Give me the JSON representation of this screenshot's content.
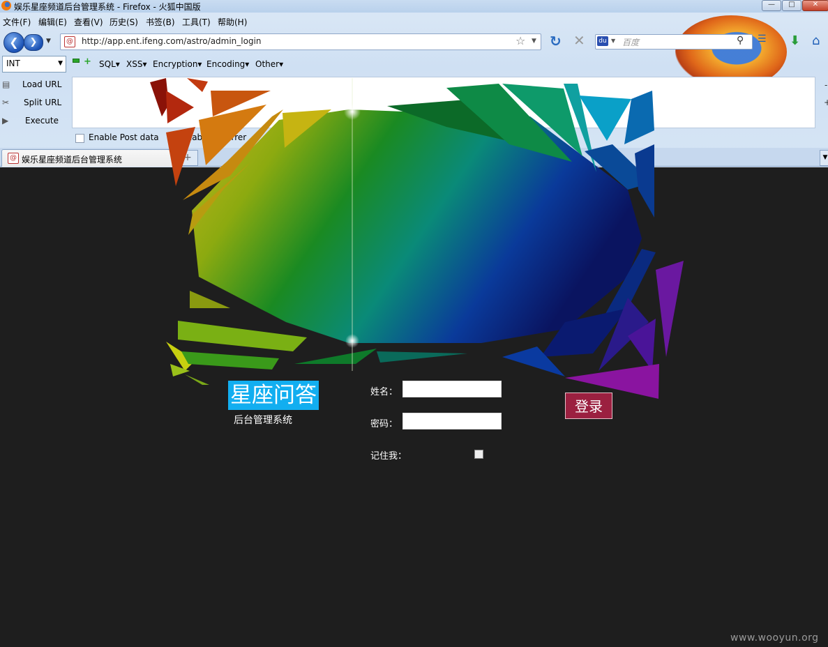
{
  "window": {
    "title": "娱乐星座频道后台管理系统 - Firefox - 火狐中国版",
    "min_glyph": "—",
    "max_glyph": "□",
    "close_glyph": "✕"
  },
  "menubar": {
    "items": [
      "文件(F)",
      "编辑(E)",
      "查看(V)",
      "历史(S)",
      "书签(B)",
      "工具(T)",
      "帮助(H)"
    ]
  },
  "navbar": {
    "url": "http://app.ent.ifeng.com/astro/admin_login",
    "search_placeholder": "百度",
    "engine_label": "du"
  },
  "hackbar": {
    "type_select": "INT",
    "menus": [
      "SQL▾",
      "XSS▾",
      "Encryption▾",
      "Encoding▾",
      "Other▾"
    ],
    "actions": [
      "Load URL",
      "Split URL",
      "Execute"
    ],
    "textarea_value": "",
    "checkboxes": [
      "Enable Post data",
      "Enable Referrer"
    ]
  },
  "tabs": {
    "active_label": "娱乐星座频道后台管理系统",
    "new_tab_glyph": "+"
  },
  "login": {
    "title": "星座问答",
    "subtitle": "后台管理系统",
    "name_label": "姓名：",
    "password_label": "密码：",
    "remember_label": "记住我：",
    "submit_label": "登录",
    "name_value": "",
    "password_value": ""
  },
  "watermark": "www.wooyun.org",
  "colors": {
    "page_bg": "#1e1e1e",
    "title_highlight": "#12aef0",
    "login_button": "#9b2040"
  }
}
